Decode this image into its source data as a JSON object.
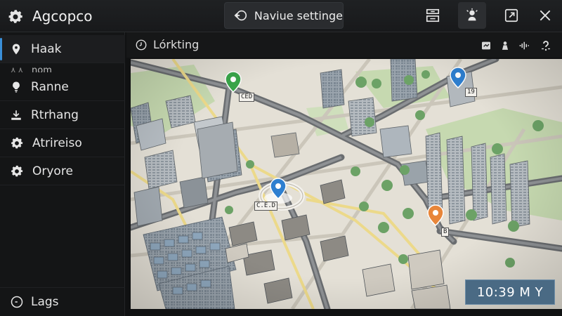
{
  "colors": {
    "header_bg": "#1f2123",
    "sidebar_bg": "#141516",
    "accent": "#3a8fd8",
    "pin_green": "#3aa54a",
    "pin_blue": "#2e7fd0",
    "pin_orange": "#e8863a",
    "clock_bg": "#4a6a84"
  },
  "header": {
    "title": "Agcopco",
    "app_icon": "gear-icon",
    "nav_button_label": "Naviue settinge",
    "nav_button_icon": "navigation-back-icon",
    "buttons": [
      {
        "icon": "layout-panel-icon"
      },
      {
        "icon": "location-person-icon"
      },
      {
        "icon": "external-window-icon"
      },
      {
        "icon": "close-icon"
      }
    ]
  },
  "sidebar": {
    "items": [
      {
        "label": "Haak",
        "icon": "location-pin-icon",
        "active": true
      },
      {
        "label": "Ranne",
        "icon": "bulb-icon"
      },
      {
        "label": "Rtrhang",
        "icon": "download-icon"
      },
      {
        "label": "Atrireiso",
        "icon": "gear-icon"
      },
      {
        "label": "Oryore",
        "icon": "gear-icon"
      }
    ],
    "sub_label": "nom",
    "bottom": {
      "label": "Lags",
      "icon": "clock-icon"
    }
  },
  "map_panel": {
    "title": "Lórkting",
    "title_icon": "clock-icon",
    "toolbar_icons": [
      "traffic-icon",
      "person-icon",
      "signal-icon",
      "help-icon"
    ],
    "pins": [
      {
        "color": "green",
        "label": "CED"
      },
      {
        "color": "blue",
        "label": "19"
      },
      {
        "color": "blue",
        "label": "C.E.D"
      },
      {
        "color": "orange",
        "label": "B"
      }
    ],
    "clock": "10:39 M Y"
  }
}
